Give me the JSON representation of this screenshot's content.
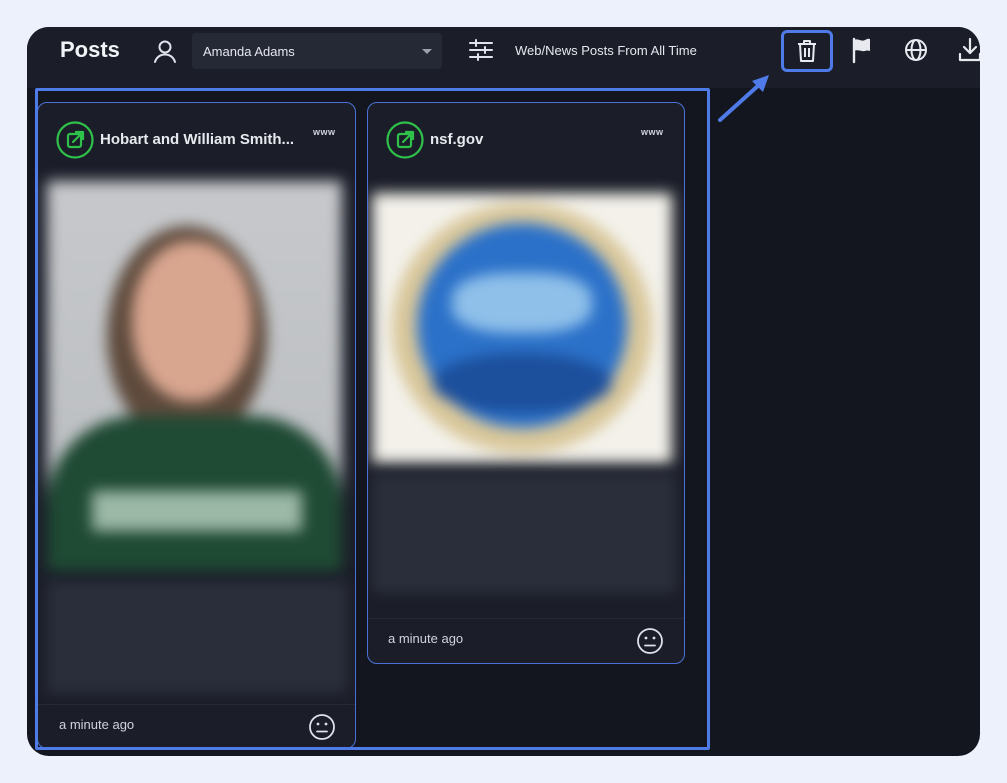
{
  "header": {
    "title": "Posts",
    "user_select": "Amanda Adams",
    "filter_label": "Web/News Posts From All Time"
  },
  "toolbar_icons": [
    "trash-icon",
    "flag-icon",
    "globe-icon",
    "download-icon"
  ],
  "colors": {
    "accent": "#4f7be8",
    "source_green": "#2fc24a",
    "background": "#14161f",
    "card": "#1b1e29"
  },
  "posts": [
    {
      "source": "Hobart and William Smith...",
      "type_badge": "www",
      "time": "a minute ago"
    },
    {
      "source": "nsf.gov",
      "type_badge": "www",
      "time": "a minute ago"
    }
  ]
}
